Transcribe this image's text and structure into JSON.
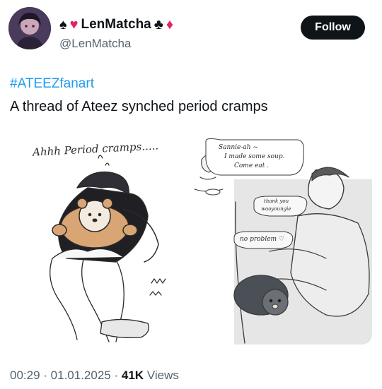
{
  "author": {
    "display_name": "LenMatcha",
    "handle": "@LenMatcha",
    "badges": [
      "spade-icon",
      "heart-icon",
      "club-icon",
      "diamond-icon"
    ]
  },
  "follow_button": {
    "label": "Follow"
  },
  "tweet": {
    "hashtag": "#ATEEZfanart",
    "text": "A thread of Ateez synched period cramps"
  },
  "media": {
    "left_panel": {
      "caption": "Ahhh Period cramps....."
    },
    "right_panel": {
      "bubble_1_line_1": "Sannie-ah ~",
      "bubble_1_line_2": "I made some soup.",
      "bubble_1_line_3": "Come eat .",
      "bubble_2_line_1": "thank you",
      "bubble_2_line_2": "wooyoungie",
      "bubble_3": "no problem ♡"
    }
  },
  "footer": {
    "time": "00:29",
    "date": "01.01.2025",
    "views_count": "41K",
    "views_label": "Views"
  },
  "colors": {
    "accent": "#1d9bf0",
    "text": "#0f1419",
    "muted": "#536471",
    "red_suit": "#e0245e"
  }
}
